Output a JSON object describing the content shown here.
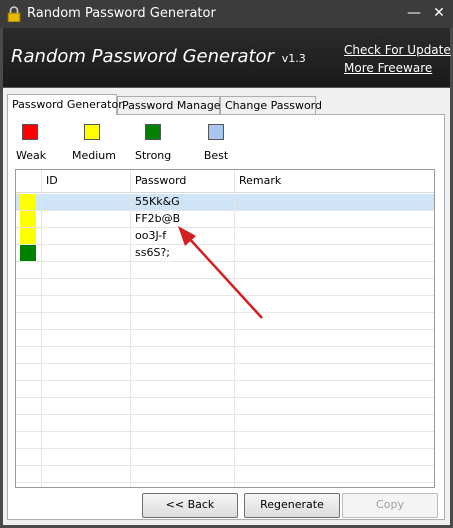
{
  "window": {
    "title": "Random Password Generator",
    "minimize_glyph": "—",
    "close_glyph": "✕"
  },
  "banner": {
    "app_title": "Random Password Generator",
    "version": "v1.3",
    "check_update": "Check For Update",
    "more_freeware": "More Freeware"
  },
  "tabs": [
    {
      "label": "Password Generator",
      "active": true
    },
    {
      "label": "Password Manager",
      "active": false
    },
    {
      "label": "Change Password",
      "active": false
    }
  ],
  "legend": [
    {
      "label": "Weak",
      "color": "#ff0000"
    },
    {
      "label": "Medium",
      "color": "#ffff00"
    },
    {
      "label": "Strong",
      "color": "#008000"
    },
    {
      "label": "Best",
      "color": "#a8c8f0"
    }
  ],
  "table": {
    "columns": [
      "ID",
      "Password",
      "Remark"
    ],
    "rows": [
      {
        "id": "",
        "password": "55Kk&G",
        "remark": "",
        "strength_color": "#ffff00",
        "selected": true
      },
      {
        "id": "",
        "password": "FF2b@B",
        "remark": "",
        "strength_color": "#ffff00",
        "selected": false
      },
      {
        "id": "",
        "password": "oo3J-f",
        "remark": "",
        "strength_color": "#ffff00",
        "selected": false
      },
      {
        "id": "",
        "password": "ss6S?;",
        "remark": "",
        "strength_color": "#008000",
        "selected": false
      }
    ]
  },
  "buttons": {
    "back": "<< Back",
    "regenerate": "Regenerate",
    "copy": "Copy"
  },
  "annotation_color": "#d42020"
}
